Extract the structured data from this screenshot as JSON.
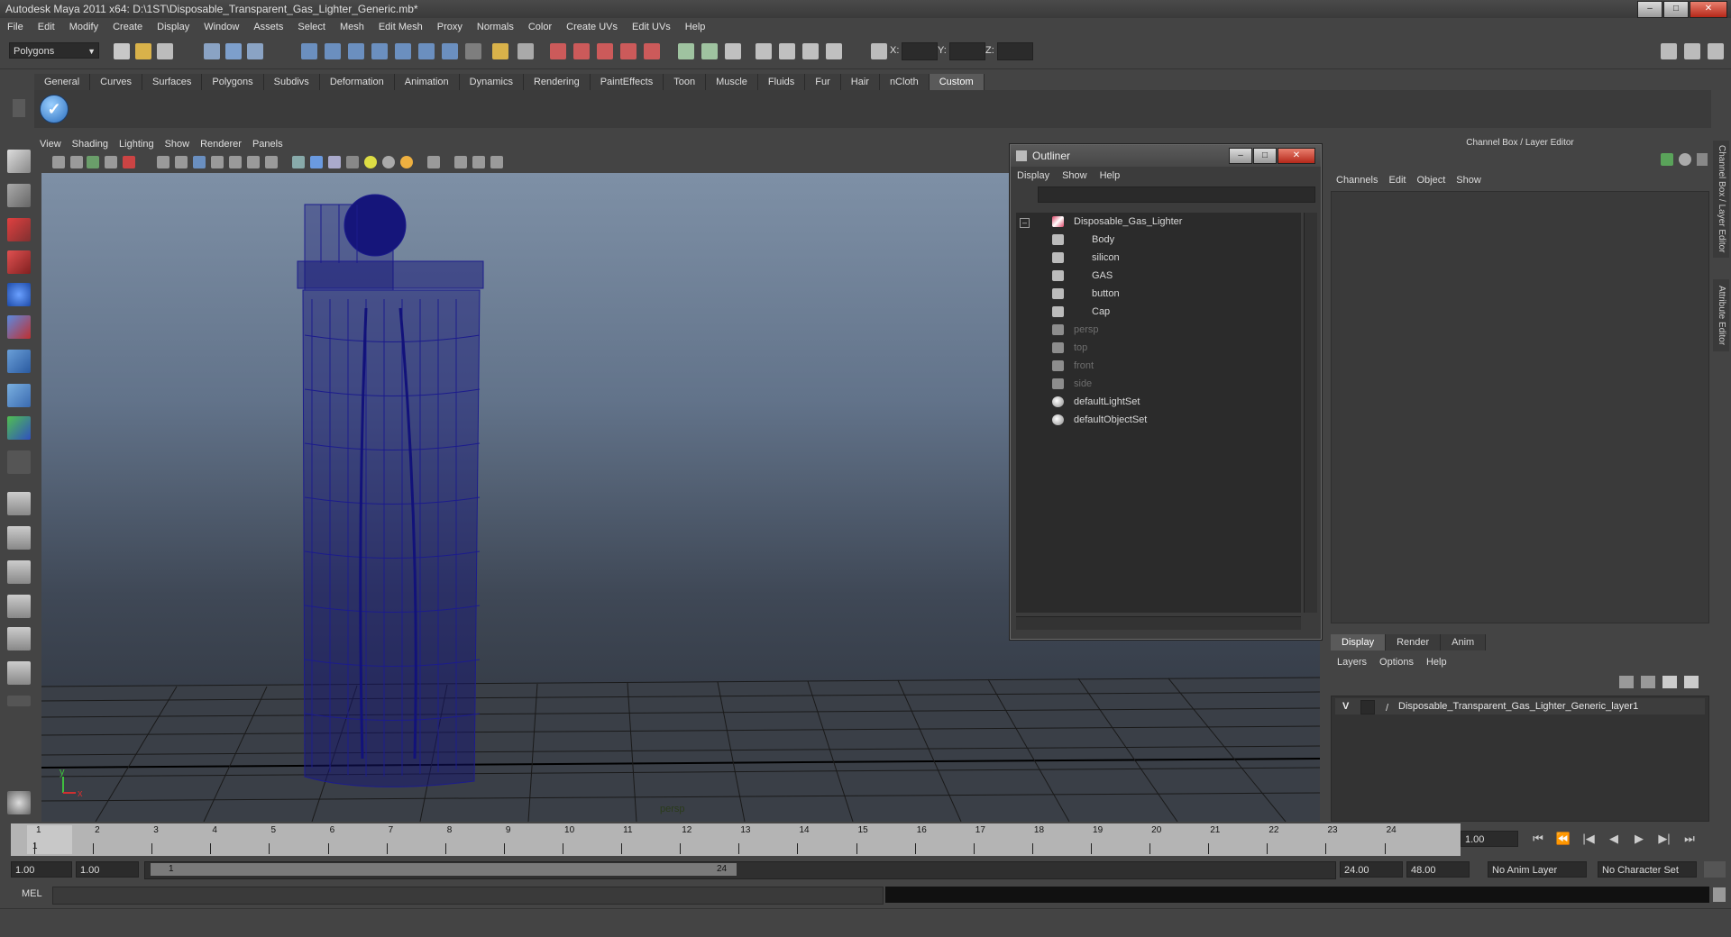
{
  "window": {
    "title": "Autodesk Maya 2011 x64: D:\\1ST\\Disposable_Transparent_Gas_Lighter_Generic.mb*"
  },
  "menubar": [
    "File",
    "Edit",
    "Modify",
    "Create",
    "Display",
    "Window",
    "Assets",
    "Select",
    "Mesh",
    "Edit Mesh",
    "Proxy",
    "Normals",
    "Color",
    "Create UVs",
    "Edit UVs",
    "Help"
  ],
  "status": {
    "mode": "Polygons",
    "x_label": "X:",
    "y_label": "Y:",
    "z_label": "Z:"
  },
  "shelf_tabs": [
    "General",
    "Curves",
    "Surfaces",
    "Polygons",
    "Subdivs",
    "Deformation",
    "Animation",
    "Dynamics",
    "Rendering",
    "PaintEffects",
    "Toon",
    "Muscle",
    "Fluids",
    "Fur",
    "Hair",
    "nCloth",
    "Custom"
  ],
  "shelf_active": "Custom",
  "viewport": {
    "menu": [
      "View",
      "Shading",
      "Lighting",
      "Show",
      "Renderer",
      "Panels"
    ],
    "camera_label": "persp",
    "axis_y": "y",
    "axis_x": "x"
  },
  "outliner": {
    "title": "Outliner",
    "menu": [
      "Display",
      "Show",
      "Help"
    ],
    "items": [
      {
        "label": "Disposable_Gas_Lighter",
        "kind": "root",
        "level": 0,
        "dim": false
      },
      {
        "label": "Body",
        "kind": "mesh",
        "level": 1,
        "dim": false
      },
      {
        "label": "silicon",
        "kind": "mesh",
        "level": 1,
        "dim": false
      },
      {
        "label": "GAS",
        "kind": "mesh",
        "level": 1,
        "dim": false
      },
      {
        "label": "button",
        "kind": "mesh",
        "level": 1,
        "dim": false
      },
      {
        "label": "Cap",
        "kind": "mesh",
        "level": 1,
        "dim": false
      },
      {
        "label": "persp",
        "kind": "camera",
        "level": 0,
        "dim": true
      },
      {
        "label": "top",
        "kind": "camera",
        "level": 0,
        "dim": true
      },
      {
        "label": "front",
        "kind": "camera",
        "level": 0,
        "dim": true
      },
      {
        "label": "side",
        "kind": "camera",
        "level": 0,
        "dim": true
      },
      {
        "label": "defaultLightSet",
        "kind": "set",
        "level": 0,
        "dim": false
      },
      {
        "label": "defaultObjectSet",
        "kind": "set",
        "level": 0,
        "dim": false
      }
    ]
  },
  "channel_box": {
    "header": "Channel Box / Layer Editor",
    "menu": [
      "Channels",
      "Edit",
      "Object",
      "Show"
    ],
    "side_tabs": [
      "Channel Box / Layer Editor",
      "Attribute Editor"
    ]
  },
  "layer_editor": {
    "tabs": [
      "Display",
      "Render",
      "Anim"
    ],
    "active_tab": "Display",
    "menu": [
      "Layers",
      "Options",
      "Help"
    ],
    "layers": [
      {
        "visible": "V",
        "name": "Disposable_Transparent_Gas_Lighter_Generic_layer1"
      }
    ]
  },
  "timeline": {
    "ticks": [
      "1",
      "2",
      "3",
      "4",
      "5",
      "6",
      "7",
      "8",
      "9",
      "10",
      "11",
      "12",
      "13",
      "14",
      "15",
      "16",
      "17",
      "18",
      "19",
      "20",
      "21",
      "22",
      "23",
      "24"
    ],
    "current_frame_marker": "1",
    "current_time": "1.00",
    "playback_buttons": [
      "⏮",
      "⏪",
      "|◀",
      "◀",
      "▶",
      "▶|",
      "⏭"
    ]
  },
  "range": {
    "start_time": "1.00",
    "playback_start": "1.00",
    "range_start_label": "1",
    "range_end_label": "24",
    "playback_end": "24.00",
    "end_time": "48.00",
    "anim_layer": "No Anim Layer",
    "character_set": "No Character Set"
  },
  "command_line": {
    "label": "MEL"
  },
  "colors": {
    "wireframe": "#1c1c8c",
    "grid": "#111111",
    "accent": "#5a5a5a"
  }
}
